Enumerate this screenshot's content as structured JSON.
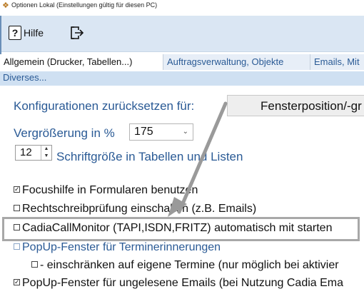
{
  "window": {
    "title": "Optionen Lokal (Einstellungen gültig für diesen PC)",
    "icon": "gear-diamond-icon"
  },
  "toolbar": {
    "help_label": "Hilfe",
    "help_icon_text": "?",
    "exit_icon": "exit-arrow-icon"
  },
  "tabs": [
    {
      "label": "Allgemein (Drucker, Tabellen...)",
      "active": true
    },
    {
      "label": "Auftragsverwaltung, Objekte",
      "active": false
    },
    {
      "label": "Emails, Mit",
      "active": false
    }
  ],
  "subtabs": {
    "diverses": "Diverses..."
  },
  "settings": {
    "reset_label": "Konfigurationen zurücksetzen für:",
    "reset_button": "Fensterposition/-gr",
    "zoom_label": "Vergrößerung in %",
    "zoom_value": "175",
    "font_size_value": "12",
    "font_size_label": "Schriftgröße in Tabellen und Listen"
  },
  "options": [
    {
      "label": "Focushilfe in Formularen benutzen",
      "checked": true,
      "disabled": false
    },
    {
      "label": "Rechtschreibprüfung einschalten (z.B. Emails)",
      "checked": false,
      "disabled": false
    },
    {
      "label": "CadiaCallMonitor (TAPI,ISDN,FRITZ) automatisch mit starten",
      "checked": false,
      "disabled": false
    },
    {
      "label": "PopUp-Fenster für Terminerinnerungen",
      "checked": false,
      "disabled": true
    },
    {
      "label": "- einschränken auf eigene Termine (nur möglich bei aktivier",
      "checked": false,
      "disabled": false
    },
    {
      "label": "PopUp-Fenster für ungelesene Emails (bei Nutzung Cadia Ema",
      "checked": true,
      "disabled": false
    }
  ],
  "colors": {
    "accent_blue": "#2a5a95",
    "toolbar_bg": "#dae6f3",
    "highlight_gray": "#a8a8a8"
  }
}
